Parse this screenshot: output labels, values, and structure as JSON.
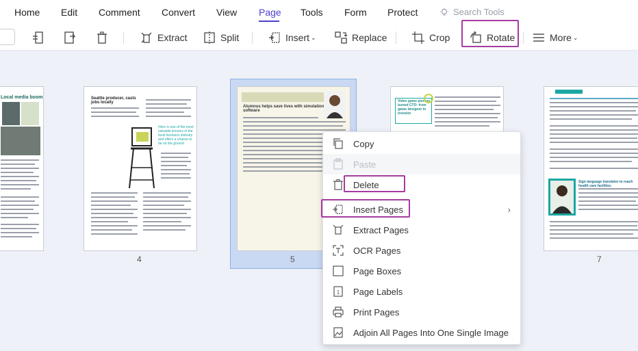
{
  "menu": {
    "items": [
      "Home",
      "Edit",
      "Comment",
      "Convert",
      "View",
      "Page",
      "Tools",
      "Form",
      "Protect"
    ],
    "active": "Page",
    "search_placeholder": "Search Tools"
  },
  "toolbar": {
    "extract": "Extract",
    "split": "Split",
    "insert": "Insert",
    "replace": "Replace",
    "crop": "Crop",
    "rotate": "Rotate",
    "more": "More"
  },
  "pages": {
    "numbers": [
      "4",
      "5",
      "7"
    ],
    "p4": {
      "headline": "Seattle producer, casts jobs locally",
      "callout": "Here is one of the most valuable lessons in the local business industry and offers a chance to be on the ground"
    },
    "p5": {
      "header": "Alumnus helps save lives with simulation software"
    },
    "p6": {
      "boxtext": "Video game pioneer turned CTO: from game designer to investor"
    },
    "p7": {
      "subhead": "Sign language translator to reach health care facilities"
    },
    "p3": {
      "headline": "Local media boom"
    }
  },
  "context_menu": {
    "items": [
      {
        "label": "Copy",
        "icon": "copy-icon",
        "disabled": false
      },
      {
        "label": "Paste",
        "icon": "paste-icon",
        "disabled": true
      },
      {
        "label": "Delete",
        "icon": "trash-icon",
        "disabled": false
      },
      {
        "label": "Insert Pages",
        "icon": "insert-pages-icon",
        "disabled": false,
        "submenu": true
      },
      {
        "label": "Extract Pages",
        "icon": "extract-pages-icon",
        "disabled": false
      },
      {
        "label": "OCR Pages",
        "icon": "ocr-icon",
        "disabled": false
      },
      {
        "label": "Page Boxes",
        "icon": "page-boxes-icon",
        "disabled": false
      },
      {
        "label": "Page Labels",
        "icon": "page-labels-icon",
        "disabled": false
      },
      {
        "label": "Print Pages",
        "icon": "print-icon",
        "disabled": false
      },
      {
        "label": "Adjoin All Pages Into One Single Image",
        "icon": "adjoin-icon",
        "disabled": false
      }
    ]
  },
  "colors": {
    "accent": "#4a3fcf",
    "highlight": "#a53aa0",
    "selection": "#c9d9f3"
  }
}
